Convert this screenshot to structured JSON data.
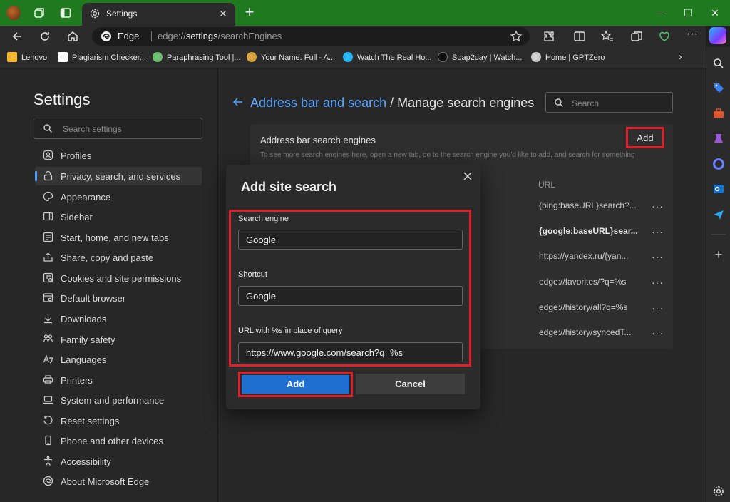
{
  "browser": {
    "tab_title": "Settings",
    "omnibox_brand": "Edge",
    "url_prefix": "edge://",
    "url_host": "settings",
    "url_path": "/searchEngines"
  },
  "bookmarks": [
    {
      "label": "Lenovo",
      "color": "#f2b631"
    },
    {
      "label": "Plagiarism Checker...",
      "color": "#ffffff"
    },
    {
      "label": "Paraphrasing Tool |...",
      "color": "#6fbf73"
    },
    {
      "label": "Your Name. Full - A...",
      "color": "#d9a441"
    },
    {
      "label": "Watch The Real Ho...",
      "color": "#29b6f6"
    },
    {
      "label": "Soap2day | Watch...",
      "color": "#111111"
    },
    {
      "label": "Home | GPTZero",
      "color": "#cccccc"
    }
  ],
  "sidebar": {
    "title": "Settings",
    "search_placeholder": "Search settings",
    "items": [
      {
        "label": "Profiles",
        "icon": "profile-icon"
      },
      {
        "label": "Privacy, search, and services",
        "icon": "lock-icon"
      },
      {
        "label": "Appearance",
        "icon": "palette-icon"
      },
      {
        "label": "Sidebar",
        "icon": "sidebar-icon"
      },
      {
        "label": "Start, home, and new tabs",
        "icon": "home-tabs-icon"
      },
      {
        "label": "Share, copy and paste",
        "icon": "share-icon"
      },
      {
        "label": "Cookies and site permissions",
        "icon": "cookies-icon"
      },
      {
        "label": "Default browser",
        "icon": "browser-icon"
      },
      {
        "label": "Downloads",
        "icon": "download-icon"
      },
      {
        "label": "Family safety",
        "icon": "family-icon"
      },
      {
        "label": "Languages",
        "icon": "languages-icon"
      },
      {
        "label": "Printers",
        "icon": "printer-icon"
      },
      {
        "label": "System and performance",
        "icon": "laptop-icon"
      },
      {
        "label": "Reset settings",
        "icon": "reset-icon"
      },
      {
        "label": "Phone and other devices",
        "icon": "phone-icon"
      },
      {
        "label": "Accessibility",
        "icon": "accessibility-icon"
      },
      {
        "label": "About Microsoft Edge",
        "icon": "edge-logo-icon"
      }
    ],
    "active_index": 1
  },
  "main": {
    "breadcrumb_link": "Address bar and search",
    "breadcrumb_sep": "/",
    "breadcrumb_current": "Manage search engines",
    "search_placeholder": "Search",
    "card": {
      "title": "Address bar search engines",
      "add_label": "Add",
      "description": "To see more search engines here, open a new tab, go to the search engine you'd like to add, and search for something",
      "url_header": "URL",
      "rows": [
        {
          "url": "{bing:baseURL}search?...",
          "bold": false
        },
        {
          "url": "{google:baseURL}sear...",
          "bold": true
        },
        {
          "url": "https://yandex.ru/{yan...",
          "bold": false
        },
        {
          "url": "edge://favorites/?q=%s",
          "bold": false
        },
        {
          "url": "edge://history/all?q=%s",
          "bold": false
        },
        {
          "url": "edge://history/syncedT...",
          "bold": false
        }
      ],
      "more_label": "···"
    }
  },
  "dialog": {
    "title": "Add site search",
    "search_engine_label": "Search engine",
    "search_engine_value": "Google",
    "shortcut_label": "Shortcut",
    "shortcut_value": "Google",
    "url_label": "URL with %s in place of query",
    "url_value": "https://www.google.com/search?q=%s",
    "add_label": "Add",
    "cancel_label": "Cancel"
  },
  "colors": {
    "titlebar": "#1f7a1f",
    "accent": "#1f6fd1",
    "link": "#5ea8ff",
    "highlight_border": "#e01f2a"
  }
}
